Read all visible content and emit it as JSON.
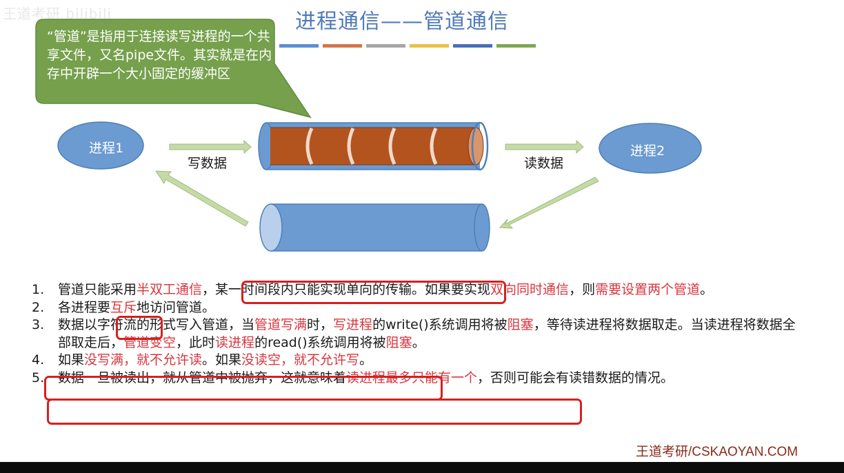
{
  "watermark": "王道考研 bilibili",
  "title": "进程通信——管道通信",
  "title_bar_colors": [
    "#5b8fd1",
    "#d2764a",
    "#a6a6a6",
    "#e9c04a",
    "#4a6fb8",
    "#7da852"
  ],
  "callout": "“管道”是指用于连接读写进程的一个共享文件，又名pipe文件。其实就是在内存中开辟一个大小固定的缓冲区",
  "diagram": {
    "process1": "进程1",
    "process2": "进程2",
    "write_label": "写数据",
    "read_label": "读数据"
  },
  "items": [
    {
      "num": "1.",
      "parts": [
        {
          "t": "管道只能采用",
          "red": false
        },
        {
          "t": "半双工通信",
          "red": true
        },
        {
          "t": "，某一时间段内只能实现单向的传输。如果要实现",
          "red": false
        },
        {
          "t": "双向同时通信",
          "red": true
        },
        {
          "t": "，则",
          "red": false
        },
        {
          "t": "需要设置两个管道",
          "red": true
        },
        {
          "t": "。",
          "red": false
        }
      ]
    },
    {
      "num": "2.",
      "parts": [
        {
          "t": "各进程要",
          "red": false
        },
        {
          "t": "互斥",
          "red": true
        },
        {
          "t": "地访问管道。",
          "red": false
        }
      ]
    },
    {
      "num": "3.",
      "parts": [
        {
          "t": "数据以字符流的形式写入管道，当",
          "red": false
        },
        {
          "t": "管道写满",
          "red": true
        },
        {
          "t": "时，",
          "red": false
        },
        {
          "t": "写进程",
          "red": true
        },
        {
          "t": "的write()系统调用将被",
          "red": false
        },
        {
          "t": "阻塞",
          "red": true
        },
        {
          "t": "，等待读进程将数据取走。当读进程将数据全部取走后，",
          "red": false
        },
        {
          "t": "管道变空",
          "red": true
        },
        {
          "t": "，此时",
          "red": false
        },
        {
          "t": "读进程",
          "red": true
        },
        {
          "t": "的read()系统调用将被",
          "red": false
        },
        {
          "t": "阻塞",
          "red": true
        },
        {
          "t": "。",
          "red": false
        }
      ]
    },
    {
      "num": "4.",
      "parts": [
        {
          "t": "如果",
          "red": false
        },
        {
          "t": "没写满，就不允许读",
          "red": true
        },
        {
          "t": "。如果",
          "red": false
        },
        {
          "t": "没读空，就不允许写",
          "red": true
        },
        {
          "t": "。",
          "red": false
        }
      ]
    },
    {
      "num": "5.",
      "parts": [
        {
          "t": "数据一旦被读出，就从管道中被抛弃，这就意味着",
          "red": false
        },
        {
          "t": "读进程最多只能有一个",
          "red": true
        },
        {
          "t": "，否则可能会有读错数据的情况。",
          "red": false
        }
      ]
    }
  ],
  "footer": "王道考研/CSKAOYAN.COM"
}
